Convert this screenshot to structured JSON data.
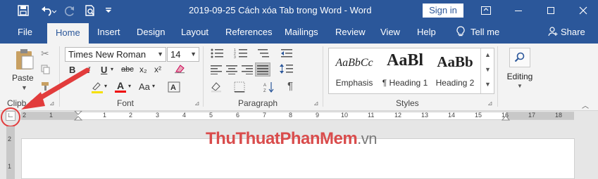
{
  "window": {
    "title": "2019-09-25 Cách xóa Tab trong Word  -  Word",
    "signin_label": "Sign in",
    "icons": [
      "save-icon",
      "undo-icon",
      "redo-icon",
      "print-preview-icon",
      "customize-qat-icon",
      "ribbon-display-icon",
      "minimize-icon",
      "maximize-icon",
      "close-icon"
    ]
  },
  "tabs": [
    "File",
    "Home",
    "Insert",
    "Design",
    "Layout",
    "References",
    "Mailings",
    "Review",
    "View",
    "Help"
  ],
  "active_tab": "Home",
  "tell_me": "Tell me",
  "share": "Share",
  "clipboard": {
    "paste_label": "Paste",
    "group_label": "Clipb"
  },
  "font": {
    "family": "Times New Roman",
    "size": "14",
    "group_label": "Font",
    "bold": "B",
    "italic": "I",
    "underline": "U",
    "strike": "abc",
    "subscript": "x₂",
    "superscript": "x²",
    "grow": "A",
    "shrink": "A",
    "case": "Aa"
  },
  "paragraph": {
    "group_label": "Paragraph"
  },
  "styles": {
    "group_label": "Styles",
    "items": [
      {
        "sample": "AaBbCc",
        "name": "Emphasis"
      },
      {
        "sample": "AaBl",
        "name": "¶ Heading 1"
      },
      {
        "sample": "AaBb",
        "name": "Heading 2"
      }
    ]
  },
  "editing": {
    "label": "Editing"
  },
  "ruler": {
    "h_numbers": [
      "2",
      "1",
      "1",
      "2",
      "3",
      "4",
      "5",
      "6",
      "7",
      "8",
      "9",
      "10",
      "11",
      "12",
      "13",
      "14",
      "15",
      "16",
      "17",
      "18"
    ],
    "v_numbers": [
      "2",
      "1"
    ],
    "tab_selector": "∟"
  },
  "watermark": {
    "part1": "ThuThuat",
    "part2": "PhanMem",
    "part3": ".vn"
  },
  "colors": {
    "accent": "#2b579a",
    "annotation": "#e23c3c"
  }
}
